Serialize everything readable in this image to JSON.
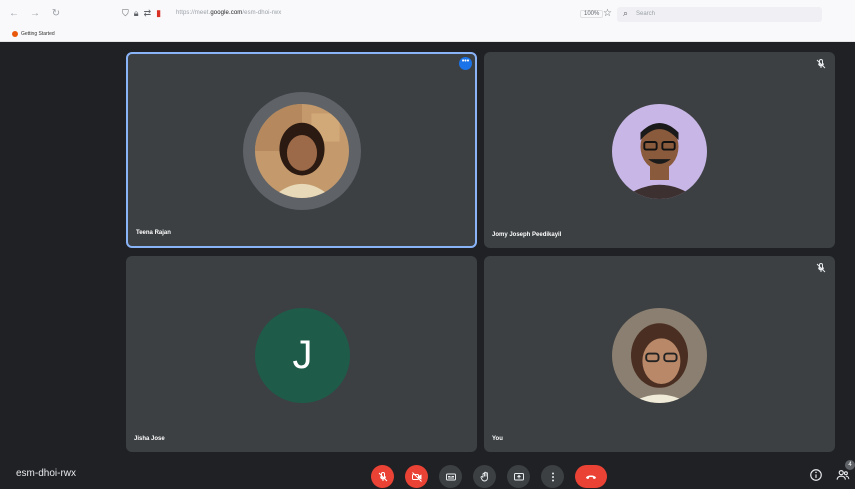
{
  "browser": {
    "url_host": "google.com",
    "zoom": "100%",
    "search_placeholder": "Search",
    "bookmark_label": "Getting Started"
  },
  "participants": [
    {
      "name": "Teena Rajan",
      "active_speaker": true,
      "avatar_type": "photo"
    },
    {
      "name": "Jomy Joseph Peedikayil",
      "muted": true,
      "avatar_type": "photo"
    },
    {
      "name": "Jisha Jose",
      "avatar_type": "letter",
      "initial": "J",
      "avatar_color": "#1e5c49"
    },
    {
      "name": "You",
      "muted": true,
      "avatar_type": "photo"
    }
  ],
  "meeting": {
    "code": "esm-dhoi-rwx"
  },
  "controls": [
    {
      "icon": "mic-off-icon",
      "state": "off"
    },
    {
      "icon": "camera-off-icon",
      "state": "off"
    },
    {
      "icon": "captions-icon"
    },
    {
      "icon": "raise-hand-icon"
    },
    {
      "icon": "present-screen-icon"
    },
    {
      "icon": "more-options-icon"
    },
    {
      "icon": "end-call-icon"
    }
  ],
  "colors": {
    "background": "#202124",
    "tile": "#3c4043",
    "active_border": "#8ab4f8",
    "danger": "#ea4335"
  }
}
